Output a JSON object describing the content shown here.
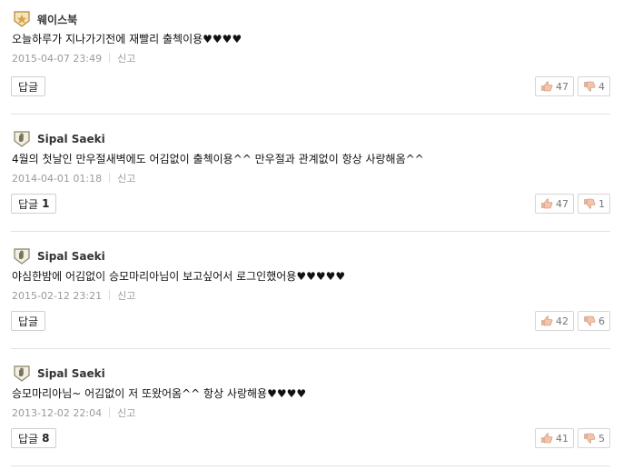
{
  "comments": [
    {
      "author": "웨이스북",
      "badge": "star-badge",
      "text": "오늘하루가 지나가기전에 재빨리 출첵이용♥♥♥♥",
      "date": "2015-04-07 23:49",
      "report": "신고",
      "reply_label": "답글",
      "reply_count": "",
      "likes": "47",
      "dislikes": "4"
    },
    {
      "author": "Sipal Saeki",
      "badge": "rookie-badge",
      "text": "4월의 첫날인 만우절새벽에도 어김없이 출첵이용^^ 만우절과 관계없이 항상 사랑해옴^^",
      "date": "2014-04-01 01:18",
      "report": "신고",
      "reply_label": "답글",
      "reply_count": "1",
      "likes": "47",
      "dislikes": "1"
    },
    {
      "author": "Sipal Saeki",
      "badge": "rookie-badge",
      "text": "야심한밤에 어김없이 승모마리아님이 보고싶어서 로그인했어용♥♥♥♥♥",
      "date": "2015-02-12 23:21",
      "report": "신고",
      "reply_label": "답글",
      "reply_count": "",
      "likes": "42",
      "dislikes": "6"
    },
    {
      "author": "Sipal Saeki",
      "badge": "rookie-badge",
      "text": "승모마리아님~ 어김없이 저 또왔어옴^^ 항상 사랑해용♥♥♥♥",
      "date": "2013-12-02 22:04",
      "report": "신고",
      "reply_label": "답글",
      "reply_count": "8",
      "likes": "41",
      "dislikes": "5"
    }
  ],
  "colors": {
    "accent": "#e07a5f",
    "badge_gold": "#d9a441",
    "meta_gray": "#9a9a9a"
  }
}
